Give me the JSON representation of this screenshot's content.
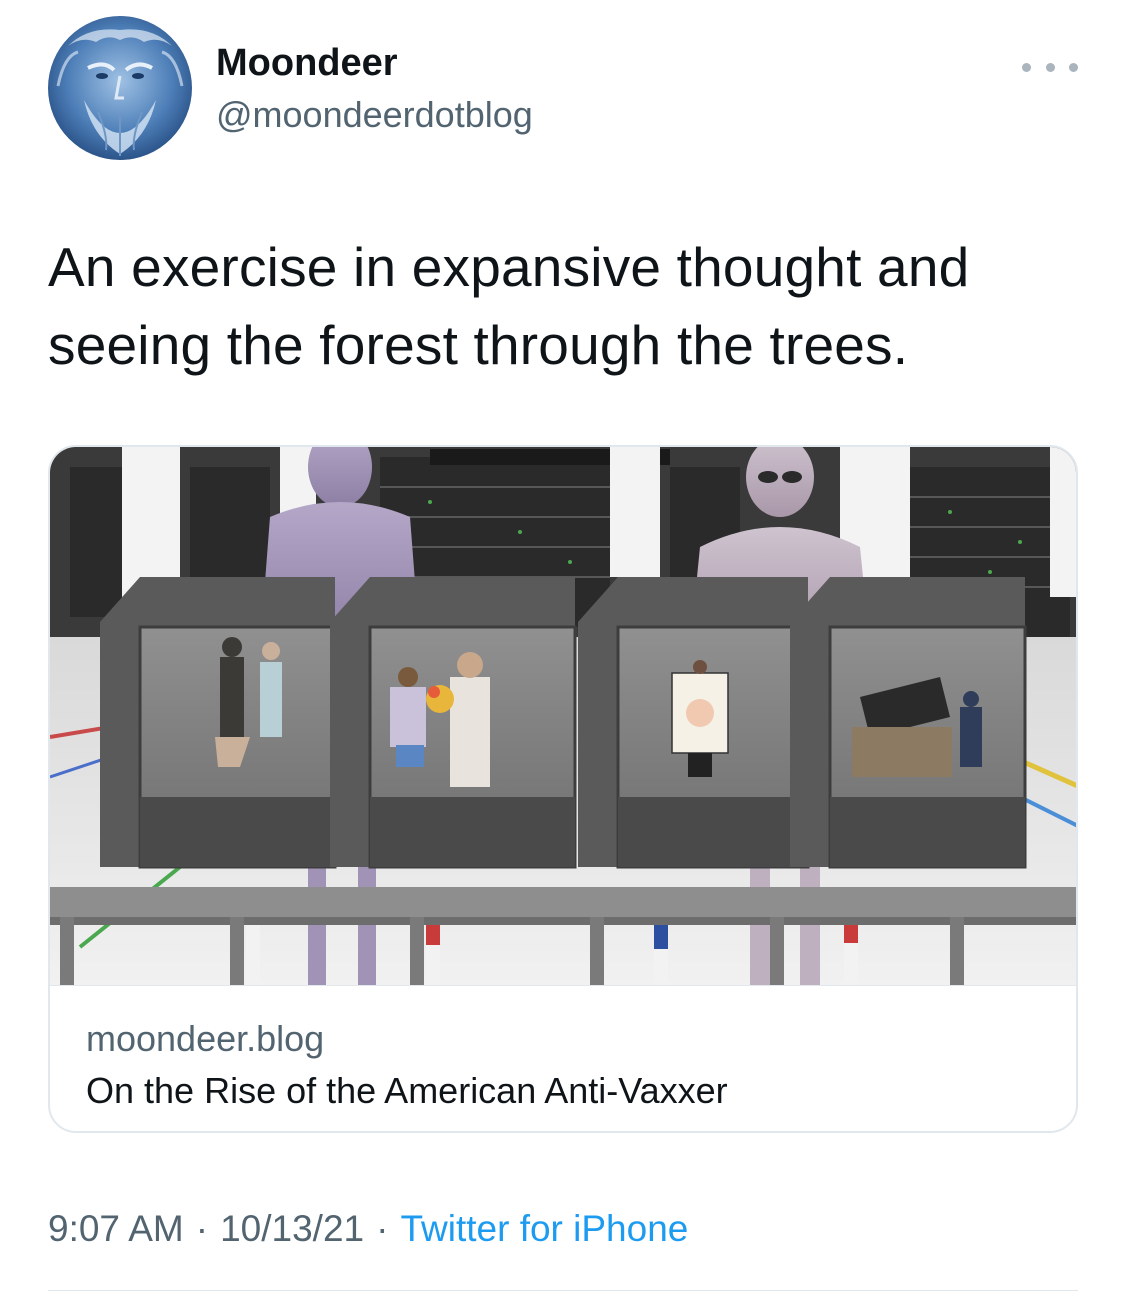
{
  "author": {
    "name": "Moondeer",
    "handle": "@moondeerdotblog",
    "avatar_icon": "bearded-face-avatar"
  },
  "more_icon": "ellipsis-icon",
  "tweet": {
    "text": "An exercise in expansive thought and seeing the forest through the trees."
  },
  "card": {
    "image_icon": "alien-lab-illustration",
    "domain": "moondeer.blog",
    "title": "On the Rise of the American Anti-Vaxxer"
  },
  "meta": {
    "time": "9:07 AM",
    "separator": "·",
    "date": "10/13/21",
    "source": "Twitter for iPhone"
  },
  "colors": {
    "text": "#0f1419",
    "secondary": "#536471",
    "link": "#1d9bf0",
    "border": "#e1e8ed"
  }
}
